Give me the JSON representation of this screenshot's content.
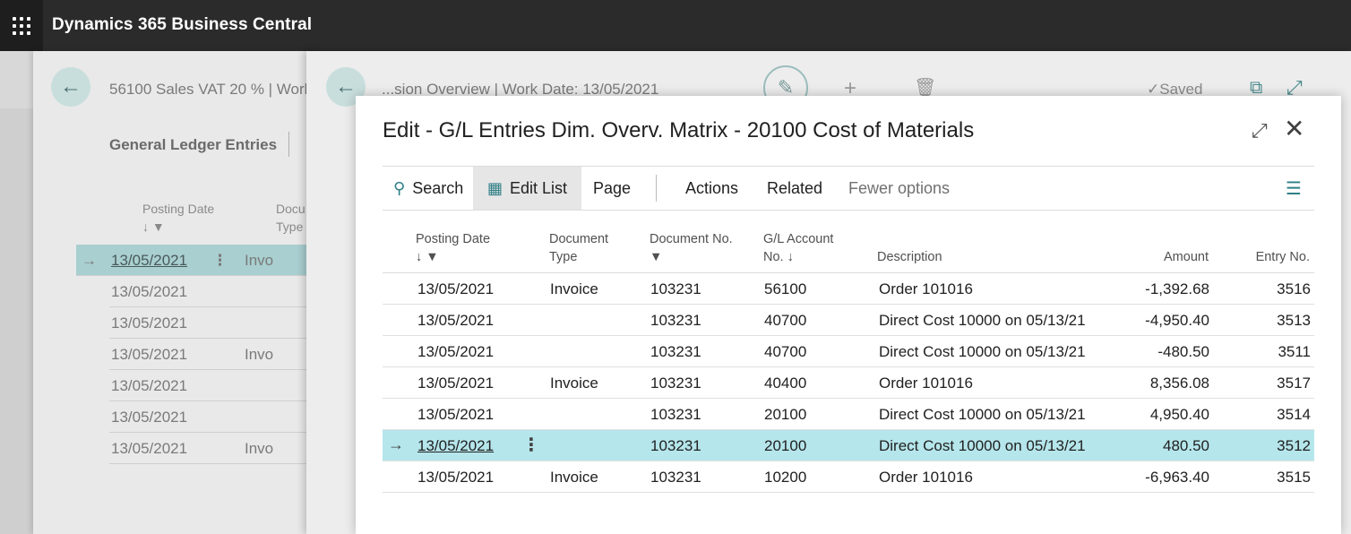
{
  "app": {
    "title": "Dynamics 365 Business Central"
  },
  "layer1": {
    "title": "56100 Sales VAT 20 % | Work",
    "subtitle": "General Ledger Entries",
    "headers": {
      "posting_date": "Posting Date",
      "doc_type": "Docu­Type",
      "doc_type_line1": "Docu",
      "doc_type_line2": "Type"
    },
    "rows": [
      {
        "date": "13/05/2021",
        "type": "Invo",
        "selected": true
      },
      {
        "date": "13/05/2021",
        "type": ""
      },
      {
        "date": "13/05/2021",
        "type": ""
      },
      {
        "date": "13/05/2021",
        "type": "Invo"
      },
      {
        "date": "13/05/2021",
        "type": ""
      },
      {
        "date": "13/05/2021",
        "type": ""
      },
      {
        "date": "13/05/2021",
        "type": "Invo"
      }
    ]
  },
  "layer2": {
    "title": "...sion Overview | Work Date: 13/05/2021",
    "saved": "Saved"
  },
  "dialog": {
    "title": "Edit - G/L Entries Dim. Overv. Matrix - 20100 Cost of Materials",
    "toolbar": {
      "search": "Search",
      "edit_list": "Edit List",
      "page": "Page",
      "actions": "Actions",
      "related": "Related",
      "fewer": "Fewer options"
    },
    "columns": {
      "posting_date": "Posting Date",
      "doc_type_1": "Document",
      "doc_type_2": "Type",
      "doc_no": "Document No.",
      "gl_1": "G/L Account",
      "gl_2": "No.",
      "description": "Description",
      "amount": "Amount",
      "entry_no": "Entry No."
    },
    "rows": [
      {
        "date": "13/05/2021",
        "type": "Invoice",
        "doc": "103231",
        "gl": "56100",
        "desc": "Order 101016",
        "amount": "-1,392.68",
        "entry": "3516"
      },
      {
        "date": "13/05/2021",
        "type": "",
        "doc": "103231",
        "gl": "40700",
        "desc": "Direct Cost 10000 on 05/13/21",
        "amount": "-4,950.40",
        "entry": "3513"
      },
      {
        "date": "13/05/2021",
        "type": "",
        "doc": "103231",
        "gl": "40700",
        "desc": "Direct Cost 10000 on 05/13/21",
        "amount": "-480.50",
        "entry": "3511"
      },
      {
        "date": "13/05/2021",
        "type": "Invoice",
        "doc": "103231",
        "gl": "40400",
        "desc": "Order 101016",
        "amount": "8,356.08",
        "entry": "3517"
      },
      {
        "date": "13/05/2021",
        "type": "",
        "doc": "103231",
        "gl": "20100",
        "desc": "Direct Cost 10000 on 05/13/21",
        "amount": "4,950.40",
        "entry": "3514"
      },
      {
        "date": "13/05/2021",
        "type": "",
        "doc": "103231",
        "gl": "20100",
        "desc": "Direct Cost 10000 on 05/13/21",
        "amount": "480.50",
        "entry": "3512",
        "selected": true
      },
      {
        "date": "13/05/2021",
        "type": "Invoice",
        "doc": "103231",
        "gl": "10200",
        "desc": "Order 101016",
        "amount": "-6,963.40",
        "entry": "3515"
      }
    ]
  },
  "colors": {
    "accent": "#2f7f86",
    "selected_row": "#b5e6eb",
    "topbar": "#2b2b2b"
  }
}
